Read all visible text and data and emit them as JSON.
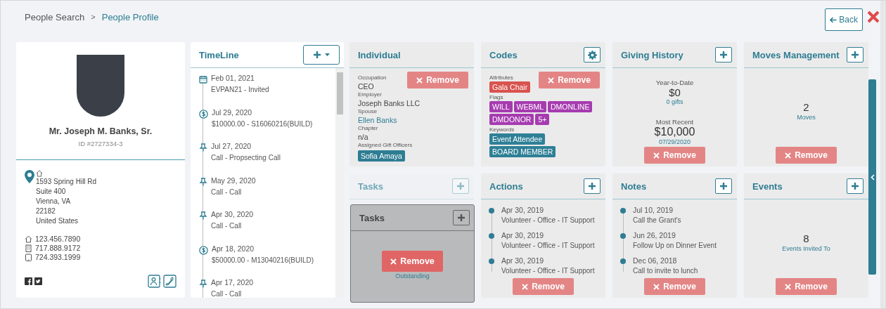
{
  "breadcrumb": {
    "items": [
      {
        "label": "People Search",
        "selected": false
      },
      {
        "label": "People Profile",
        "selected": true
      }
    ],
    "separator": ">"
  },
  "back_button": "Back",
  "profile": {
    "name": "Mr. Joseph M. Banks, Sr.",
    "id": "ID #2727334-3",
    "address": [
      "1593 Spring Hill Rd",
      "Suite 400",
      "Vienna, VA",
      "22182",
      "United States"
    ],
    "phones": [
      {
        "kind": "home",
        "number": "123.456.7890"
      },
      {
        "kind": "office",
        "number": "717.888.9172"
      },
      {
        "kind": "mobile",
        "number": "724.393.1999"
      }
    ]
  },
  "timeline": {
    "title": "TimeLine",
    "items": [
      {
        "kind": "event",
        "date": "Feb 01, 2021",
        "text": "EVPAN21 - Invited"
      },
      {
        "kind": "gift",
        "date": "Jul 29, 2020",
        "text": "$10000.00 - S16060216(BUILD)"
      },
      {
        "kind": "call",
        "date": "Jul 27, 2020",
        "text": "Call - Propsecting Call"
      },
      {
        "kind": "call",
        "date": "May 29, 2020",
        "text": "Call - Call"
      },
      {
        "kind": "call",
        "date": "Apr 30, 2020",
        "text": "Call - Call"
      },
      {
        "kind": "gift",
        "date": "Apr 18, 2020",
        "text": "$50000.00 - M13040216(BUILD)"
      },
      {
        "kind": "call",
        "date": "Apr 17, 2020",
        "text": "Call - Call"
      }
    ]
  },
  "widgets": [
    {
      "kind": "fields",
      "title": "Individual",
      "add_button": false,
      "settings_button": false,
      "faded": false,
      "remove": "Remove",
      "fields": [
        {
          "label": "Occupation",
          "value": "CEO",
          "kind": "text"
        },
        {
          "label": "Employer",
          "value": "Joseph Banks LLC",
          "kind": "text"
        },
        {
          "label": "Spouse",
          "value": "Ellen Banks",
          "kind": "link"
        },
        {
          "label": "Chapter",
          "value": "n/a",
          "kind": "text"
        },
        {
          "label": "Assigned Gift Officers",
          "value": "Sofia Amaya",
          "kind": "tag"
        }
      ]
    },
    {
      "kind": "codes",
      "title": "Codes",
      "add_button": false,
      "settings_button": true,
      "faded": false,
      "remove": "Remove",
      "groups": [
        {
          "label": "Attributes",
          "tags": [
            {
              "text": "Gala Chair",
              "color": "#d9534f"
            }
          ]
        },
        {
          "label": "Flags",
          "tags": [
            {
              "text": "WILL",
              "color": "#a63bb0"
            },
            {
              "text": "WEBML",
              "color": "#a63bb0"
            },
            {
              "text": "DMONLINE",
              "color": "#a63bb0"
            },
            {
              "text": "DMDONOR",
              "color": "#a63bb0"
            },
            {
              "text": "5+",
              "color": "#a63bb0"
            }
          ]
        },
        {
          "label": "Keywords",
          "tags": [
            {
              "text": "Event Attendee",
              "color": "#2e8096"
            },
            {
              "text": "BOARD MEMBER",
              "color": "#2e8096"
            }
          ]
        }
      ]
    },
    {
      "kind": "giving",
      "title": "Giving History",
      "add_button": true,
      "settings_button": false,
      "faded": false,
      "remove": "Remove",
      "ytd_label": "Year-to-Date",
      "ytd_amount": "$0",
      "ytd_caption": "0 gifts",
      "recent_label": "Most Recent",
      "recent_amount": "$10,000",
      "recent_date": "07/29/2020"
    },
    {
      "kind": "count",
      "title": "Moves Management",
      "add_button": true,
      "settings_button": false,
      "faded": false,
      "remove": "Remove",
      "count": "2",
      "caption": "Moves"
    },
    {
      "kind": "count",
      "title": "Tasks",
      "add_button": true,
      "settings_button": false,
      "faded": true
    },
    {
      "kind": "list",
      "title": "Actions",
      "add_button": true,
      "settings_button": false,
      "faded": false,
      "remove": "Remove",
      "items": [
        {
          "date": "Apr 30, 2019",
          "text": "Volunteer - Office - IT Support"
        },
        {
          "date": "Apr 30, 2019",
          "text": "Volunteer - Office - IT Support"
        },
        {
          "date": "Apr 30, 2019",
          "text": "Volunteer - Office - IT Support"
        }
      ]
    },
    {
      "kind": "list",
      "title": "Notes",
      "add_button": true,
      "settings_button": false,
      "faded": false,
      "remove": "Remove",
      "items": [
        {
          "date": "Jul 10, 2019",
          "text": "Call the Grant's"
        },
        {
          "date": "Jun 26, 2019",
          "text": "Follow Up on Dinner Event"
        },
        {
          "date": "Dec 06, 2018",
          "text": "Call to invite to lunch"
        }
      ]
    },
    {
      "kind": "count",
      "title": "Events",
      "add_button": true,
      "settings_button": false,
      "faded": false,
      "remove": "Remove",
      "count": "8",
      "caption": "Events Invited To"
    }
  ],
  "dragged_widget": {
    "title": "Tasks",
    "remove": "Remove",
    "caption": "Outstanding"
  }
}
